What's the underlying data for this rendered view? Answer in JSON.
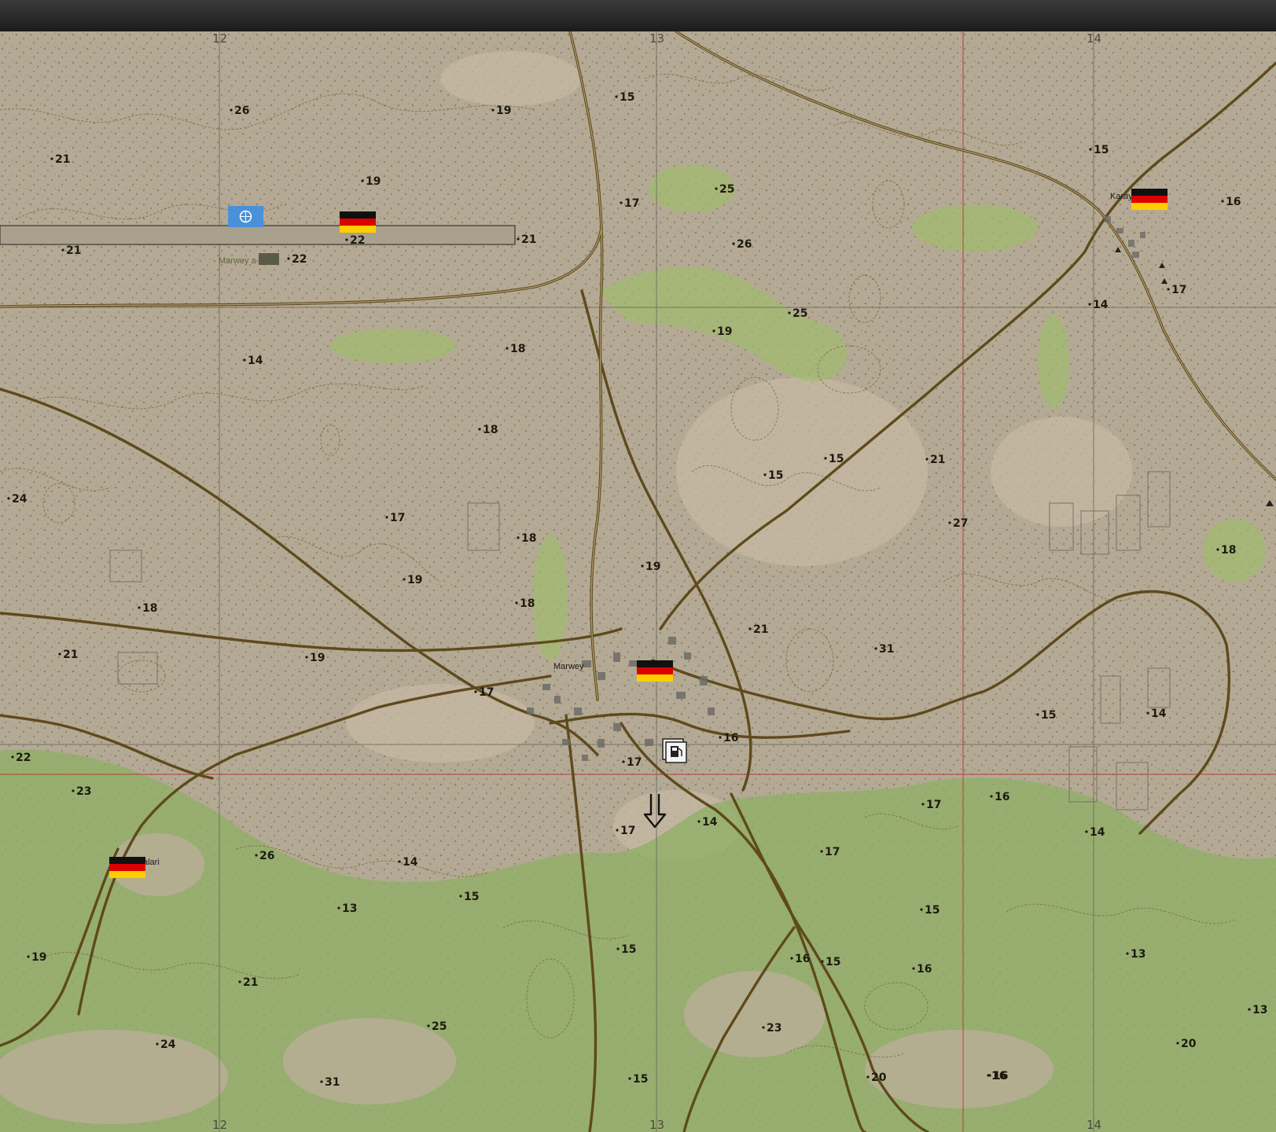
{
  "map": {
    "grid_labels": [
      {
        "label": "12",
        "col": "x12"
      },
      {
        "label": "13",
        "col": "x13"
      },
      {
        "label": "14",
        "col": "x14"
      }
    ],
    "towns": [
      {
        "name": "Marwey",
        "id": "marwey"
      },
      {
        "name": "Karay",
        "id": "karay"
      },
      {
        "name": "alari",
        "id": "alari"
      },
      {
        "name": "Marwey a",
        "id": "marwey-airfield"
      }
    ],
    "elevations": [
      "26",
      "19",
      "15",
      "21",
      "19",
      "17",
      "25",
      "15",
      "16",
      "21",
      "22",
      "21",
      "22",
      "26",
      "25",
      "14",
      "17",
      "14",
      "19",
      "18",
      "18",
      "15",
      "24",
      "15",
      "21",
      "27",
      "17",
      "18",
      "19",
      "18",
      "19",
      "18",
      "18",
      "21",
      "19",
      "31",
      "17",
      "21",
      "15",
      "14",
      "22",
      "16",
      "17",
      "23",
      "17",
      "16",
      "14",
      "14",
      "17",
      "26",
      "14",
      "13",
      "15",
      "17",
      "15",
      "15",
      "13",
      "16",
      "21",
      "13",
      "24",
      "25",
      "23",
      "20",
      "15",
      "31",
      "16",
      "20",
      "19",
      "16",
      "15",
      "16"
    ],
    "markers": [
      {
        "type": "flag",
        "country": "Germany",
        "id": "flag-marwey"
      },
      {
        "type": "flag",
        "country": "Germany",
        "id": "flag-airfield"
      },
      {
        "type": "flag",
        "country": "Germany",
        "id": "flag-karay"
      },
      {
        "type": "flag",
        "country": "Germany",
        "id": "flag-alari"
      },
      {
        "type": "flag",
        "country": "United Nations",
        "id": "flag-un"
      },
      {
        "type": "icon",
        "name": "fuel-station-icon"
      },
      {
        "type": "icon",
        "name": "move-down-arrow-icon"
      }
    ],
    "colors": {
      "terrain": "#b2a792",
      "vegetation": "#8fb268",
      "road": "#6b5520",
      "grid": "#5a5a50",
      "grid_red": "#b0302a"
    }
  }
}
